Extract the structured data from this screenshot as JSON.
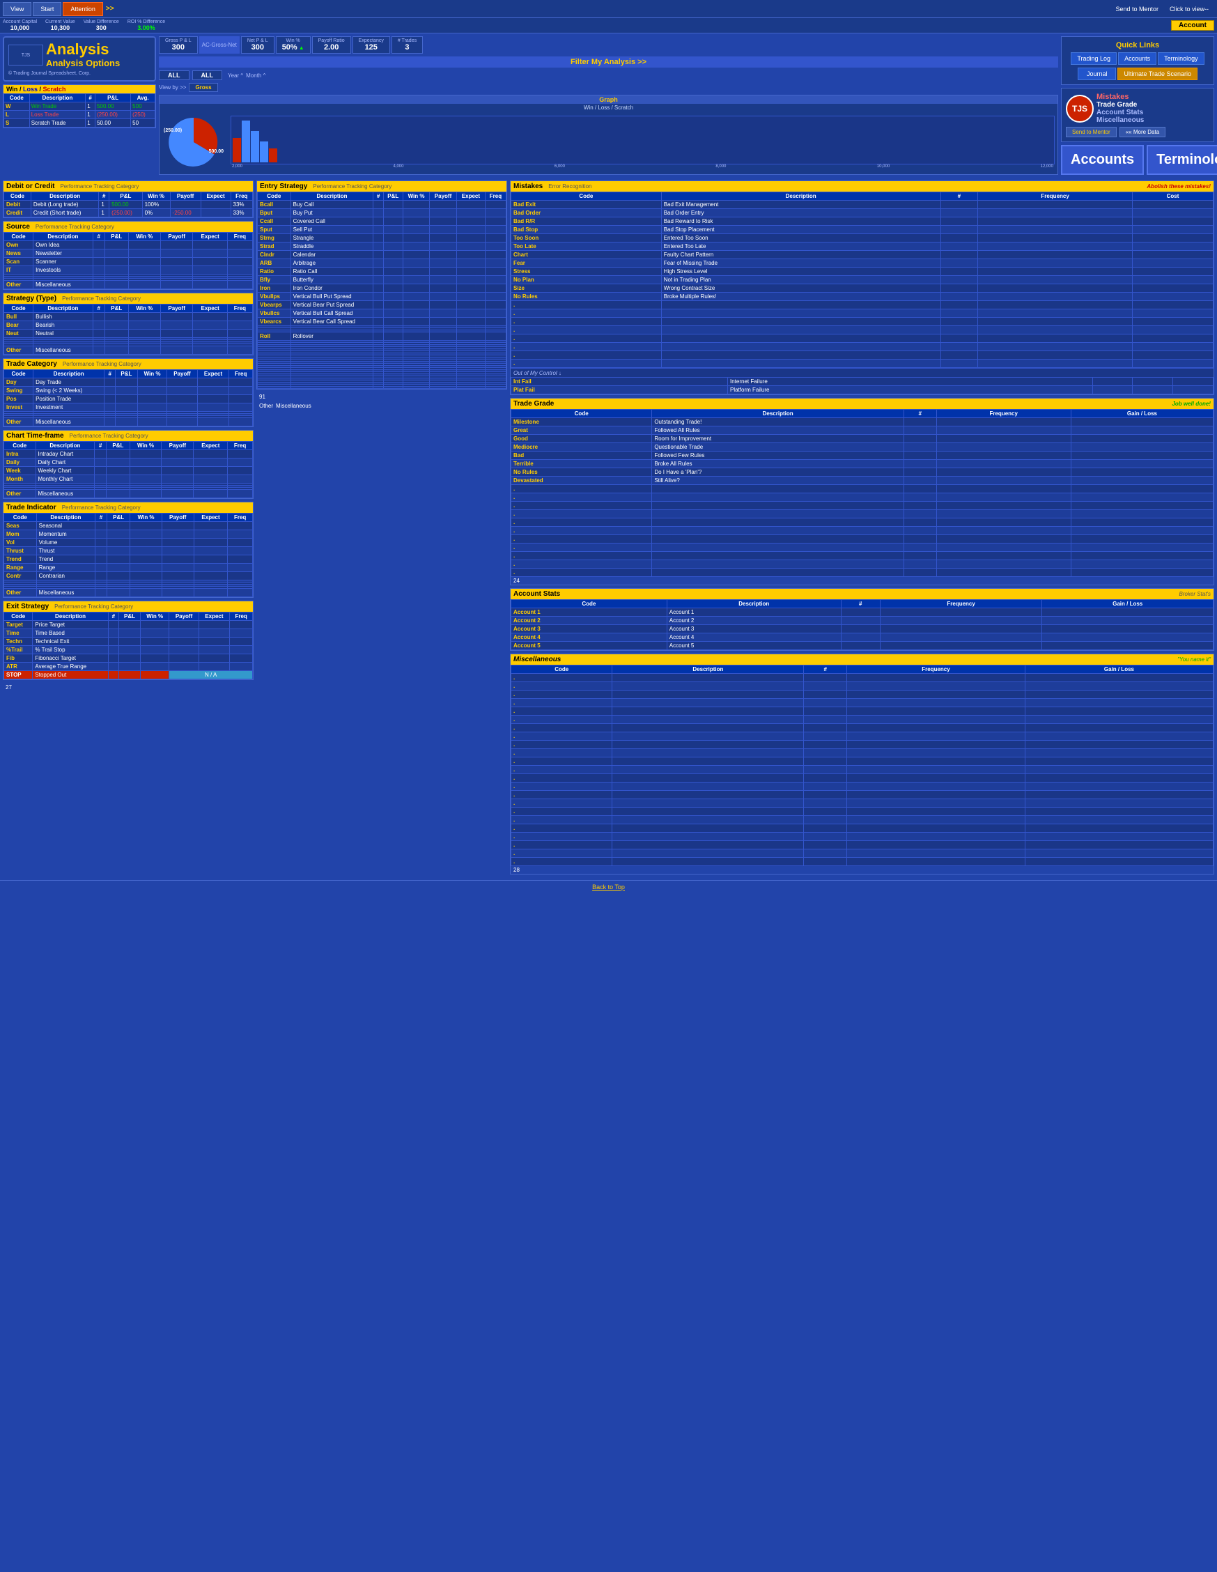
{
  "app": {
    "title": "Analysis Options",
    "subtitle": "Analysis",
    "copyright": "© Trading Journal Spreadsheet, Corp."
  },
  "topbar": {
    "view": "View",
    "start": "Start",
    "attention": "Attention",
    "nav_arrow": ">>",
    "send_to_mentor": "Send to Mentor",
    "click_to_view": "Click to view--",
    "more_data": "«« More Data"
  },
  "account_row": {
    "account_capital_label": "Account Capital",
    "current_value_label": "Current Value",
    "value_difference_label": "Value Difference",
    "roi_label": "ROI % Difference",
    "account_capital": "10,000",
    "current_value": "10,300",
    "value_difference": "300",
    "roi": "3.00%",
    "account_tab": "Account"
  },
  "stats": {
    "gross_pnl_label": "Gross P & L",
    "gross_pnl": "300",
    "ac_gross_net": "AC-Gross-Net",
    "net_pnl_label": "Net P & L",
    "net_pnl": "300",
    "win_label": "Win %",
    "win": "50%",
    "payoff_label": "Payoff Ratio",
    "payoff": "2.00",
    "expectancy_label": "Expectancy",
    "expectancy": "125",
    "trades_label": "# Trades",
    "trades": "3",
    "all1": "ALL",
    "all2": "ALL",
    "year_label": "Year ^",
    "month_label": "Month ^",
    "view_by": "View by >>",
    "gross_label": "Gross"
  },
  "graph": {
    "title": "Graph",
    "subtitle": "Win / Loss / Scratch",
    "bar_values": [
      12000,
      10000,
      8000,
      6000,
      4000,
      2000
    ],
    "pie_labels": [
      "(250.00)",
      "500.00"
    ],
    "pie_red_pct": 35,
    "pie_blue_pct": 65
  },
  "quick_links": {
    "title": "Quick Links",
    "filter_btn": "Filter My Analysis >>",
    "trading_log": "Trading Log",
    "accounts": "Accounts",
    "terminology": "Terminology",
    "journal": "Journal",
    "ultimate": "Ultimate Trade Scenario"
  },
  "win_loss": {
    "header": "Win / Loss / Scratch",
    "columns": [
      "Code",
      "Description",
      "#",
      "P&L",
      "Avg."
    ],
    "rows": [
      {
        "code": "W",
        "desc": "Win Trade",
        "num": "1",
        "pnl": "500.00",
        "avg": "500",
        "type": "win"
      },
      {
        "code": "L",
        "desc": "Loss Trade",
        "num": "1",
        "pnl": "(250.00)",
        "avg": "(250)",
        "type": "loss"
      },
      {
        "code": "S",
        "desc": "Scratch Trade",
        "num": "1",
        "pnl": "50.00",
        "avg": "50",
        "type": "scratch"
      }
    ]
  },
  "debit_credit": {
    "title": "Debit or Credit",
    "subtitle": "Performance Tracking Category",
    "columns": [
      "Code",
      "Description",
      "#",
      "P&L",
      "Win %",
      "Payoff Ratio",
      "Expectancy",
      "Frequency"
    ],
    "rows": [
      {
        "code": "Debit",
        "desc": "Debit (Long trade)",
        "num": "1",
        "pnl": "500.00",
        "win": "100%",
        "payoff": "",
        "expectancy": "",
        "frequency": "33%"
      },
      {
        "code": "Credit",
        "desc": "Credit (Short trade)",
        "num": "1",
        "pnl": "(250.00)",
        "win": "0%",
        "payoff": "-250.00",
        "expectancy": "",
        "frequency": "33%"
      }
    ]
  },
  "source": {
    "title": "Source",
    "subtitle": "Performance Tracking Category",
    "columns": [
      "Code",
      "Description",
      "#",
      "P&L",
      "Win %",
      "Payoff Ratio",
      "Expectancy",
      "Frequency"
    ],
    "rows": [
      {
        "code": "Own",
        "desc": "Own Idea"
      },
      {
        "code": "News",
        "desc": "Newsletter"
      },
      {
        "code": "Scan",
        "desc": "Scanner"
      },
      {
        "code": "IT",
        "desc": "Investools"
      },
      {
        "code": "",
        "desc": ""
      },
      {
        "code": "",
        "desc": ""
      },
      {
        "code": "",
        "desc": ""
      },
      {
        "code": "Other",
        "desc": "Miscellaneous"
      }
    ]
  },
  "strategy_type": {
    "title": "Strategy (Type)",
    "subtitle": "Performance Tracking Category",
    "columns": [
      "Code",
      "Description",
      "#",
      "P&L",
      "Win %",
      "Payoff Ratio",
      "Expectancy",
      "Frequency"
    ],
    "rows": [
      {
        "code": "Bull",
        "desc": "Bullish"
      },
      {
        "code": "Bear",
        "desc": "Bearish"
      },
      {
        "code": "Neut",
        "desc": "Neutral"
      },
      {
        "code": "",
        "desc": ""
      },
      {
        "code": "",
        "desc": ""
      },
      {
        "code": "",
        "desc": ""
      },
      {
        "code": "",
        "desc": ""
      },
      {
        "code": "Other",
        "desc": "Miscellaneous"
      }
    ]
  },
  "trade_category": {
    "title": "Trade Category",
    "subtitle": "Performance Tracking Category",
    "columns": [
      "Code",
      "Description",
      "#",
      "P&L",
      "Win %",
      "Payoff Ratio",
      "Expectancy",
      "Frequency"
    ],
    "rows": [
      {
        "code": "Day",
        "desc": "Day Trade"
      },
      {
        "code": "Swing",
        "desc": "Swing (< 2 Weeks)"
      },
      {
        "code": "Pos",
        "desc": "Position Trade"
      },
      {
        "code": "Invest",
        "desc": "Investment"
      },
      {
        "code": "",
        "desc": ""
      },
      {
        "code": "",
        "desc": ""
      },
      {
        "code": "",
        "desc": ""
      },
      {
        "code": "Other",
        "desc": "Miscellaneous"
      }
    ]
  },
  "chart_timeframe": {
    "title": "Chart Time-frame",
    "subtitle": "Performance Tracking Category",
    "columns": [
      "Code",
      "Description",
      "#",
      "P&L",
      "Win %",
      "Payoff Ratio",
      "Expectancy",
      "Frequency"
    ],
    "rows": [
      {
        "code": "Intra",
        "desc": "Intraday Chart"
      },
      {
        "code": "Daily",
        "desc": "Daily Chart"
      },
      {
        "code": "Week",
        "desc": "Weekly Chart"
      },
      {
        "code": "Month",
        "desc": "Monthly Chart"
      },
      {
        "code": "",
        "desc": ""
      },
      {
        "code": "",
        "desc": ""
      },
      {
        "code": "",
        "desc": ""
      },
      {
        "code": "Other",
        "desc": "Miscellaneous"
      }
    ]
  },
  "trade_indicator": {
    "title": "Trade Indicator",
    "subtitle": "Performance Tracking Category",
    "columns": [
      "Code",
      "Description",
      "#",
      "P&L",
      "Win %",
      "Payoff Ratio",
      "Expectancy",
      "Frequency"
    ],
    "rows": [
      {
        "code": "Seas",
        "desc": "Seasonal"
      },
      {
        "code": "Mom",
        "desc": "Momentum"
      },
      {
        "code": "Vol",
        "desc": "Volume"
      },
      {
        "code": "Thrust",
        "desc": "Thrust"
      },
      {
        "code": "Trend",
        "desc": "Trend"
      },
      {
        "code": "Range",
        "desc": "Range"
      },
      {
        "code": "Contr",
        "desc": "Contrarian"
      },
      {
        "code": "",
        "desc": ""
      },
      {
        "code": "",
        "desc": ""
      },
      {
        "code": "",
        "desc": ""
      },
      {
        "code": "",
        "desc": ""
      },
      {
        "code": "Other",
        "desc": "Miscellaneous"
      }
    ]
  },
  "exit_strategy": {
    "title": "Exit Strategy",
    "subtitle": "Performance Tracking Category",
    "columns": [
      "Code",
      "Description",
      "#",
      "P&L",
      "Win %",
      "Payoff Ratio",
      "Expectancy",
      "Frequency"
    ],
    "rows": [
      {
        "code": "Target",
        "desc": "Price Target"
      },
      {
        "code": "Time",
        "desc": "Time Based"
      },
      {
        "code": "Techn",
        "desc": "Technical Exit"
      },
      {
        "code": "%Trail",
        "desc": "% Trail Stop"
      },
      {
        "code": "Fib",
        "desc": "Fibonacci Target"
      },
      {
        "code": "ATR",
        "desc": "Average True Range"
      },
      {
        "code": "STOP",
        "desc": "Stopped Out",
        "stopped": true,
        "na": true
      }
    ]
  },
  "entry_strategy": {
    "title": "Entry Strategy",
    "subtitle": "Performance Tracking Category",
    "columns": [
      "Code",
      "Description",
      "#",
      "P&L",
      "Win %",
      "Payoff Ratio",
      "Expectancy",
      "Frequency"
    ],
    "rows": [
      {
        "code": "Bcall",
        "desc": "Buy Call"
      },
      {
        "code": "Bput",
        "desc": "Buy Put"
      },
      {
        "code": "Ccall",
        "desc": "Covered Call"
      },
      {
        "code": "Sput",
        "desc": "Sell Put"
      },
      {
        "code": "Strng",
        "desc": "Strangle"
      },
      {
        "code": "Strad",
        "desc": "Straddle"
      },
      {
        "code": "Clndr",
        "desc": "Calendar"
      },
      {
        "code": "ARB",
        "desc": "Arbitrage"
      },
      {
        "code": "Ratio",
        "desc": "Ratio Call"
      },
      {
        "code": "Bfly",
        "desc": "Butterfly"
      },
      {
        "code": "Iron",
        "desc": "Iron Condor"
      },
      {
        "code": "Vbullps",
        "desc": "Vertical Bull Put Spread"
      },
      {
        "code": "Vbearps",
        "desc": "Vertical Bear Put Spread"
      },
      {
        "code": "Vbullcs",
        "desc": "Vertical Bull Call Spread"
      },
      {
        "code": "Vbearcs",
        "desc": "Vertical Bear Call Spread"
      },
      {
        "code": "",
        "desc": ""
      },
      {
        "code": "",
        "desc": ""
      },
      {
        "code": "",
        "desc": ""
      },
      {
        "code": "Roll",
        "desc": "Rollover"
      },
      {
        "code": "",
        "desc": ""
      },
      {
        "code": "",
        "desc": ""
      },
      {
        "code": "",
        "desc": ""
      },
      {
        "code": "",
        "desc": ""
      },
      {
        "code": "",
        "desc": ""
      },
      {
        "code": "",
        "desc": ""
      },
      {
        "code": "",
        "desc": ""
      },
      {
        "code": "",
        "desc": ""
      },
      {
        "code": "",
        "desc": ""
      },
      {
        "code": "",
        "desc": ""
      },
      {
        "code": "",
        "desc": ""
      },
      {
        "code": "",
        "desc": ""
      },
      {
        "code": "",
        "desc": ""
      },
      {
        "code": "",
        "desc": ""
      },
      {
        "code": "",
        "desc": ""
      },
      {
        "code": "",
        "desc": ""
      },
      {
        "code": "",
        "desc": ""
      },
      {
        "code": "",
        "desc": ""
      },
      {
        "code": "",
        "desc": ""
      },
      {
        "code": "",
        "desc": ""
      },
      {
        "code": "",
        "desc": ""
      },
      {
        "code": "",
        "desc": ""
      },
      {
        "code": "",
        "desc": ""
      }
    ],
    "footer_num": "91",
    "footer_other": "Other",
    "footer_misc": "Miscellaneous"
  },
  "mistakes": {
    "title": "Mistakes",
    "subtitle": "Error Recognition",
    "action": "Abolish these mistakes!",
    "columns": [
      "Code",
      "Description",
      "#",
      "Frequency",
      "Cost"
    ],
    "rows": [
      {
        "code": "Bad Exit",
        "desc": "Bad Exit Management"
      },
      {
        "code": "Bad Order",
        "desc": "Bad Order Entry"
      },
      {
        "code": "Bad R/R",
        "desc": "Bad Reward to Risk"
      },
      {
        "code": "Bad Stop",
        "desc": "Bad Stop Placement"
      },
      {
        "code": "Too Soon",
        "desc": "Entered Too Soon"
      },
      {
        "code": "Too Late",
        "desc": "Entered Too Late"
      },
      {
        "code": "Chart",
        "desc": "Faulty Chart Pattern"
      },
      {
        "code": "Fear",
        "desc": "Fear of Missing Trade"
      },
      {
        "code": "Stress",
        "desc": "High Stress Level"
      },
      {
        "code": "No Plan",
        "desc": "Not in Trading Plan"
      },
      {
        "code": "Size",
        "desc": "Wrong Contract Size"
      },
      {
        "code": "No Rules",
        "desc": "Broke Multiple Rules!"
      },
      {
        "code": ".",
        "desc": ""
      },
      {
        "code": ".",
        "desc": ""
      },
      {
        "code": ".",
        "desc": ""
      },
      {
        "code": ".",
        "desc": ""
      },
      {
        "code": ".",
        "desc": ""
      },
      {
        "code": ".",
        "desc": ""
      },
      {
        "code": ".",
        "desc": ""
      },
      {
        "code": ".",
        "desc": ""
      }
    ],
    "out_of_control": "Out of My Control ↓",
    "int_fail_code": "Int Fail",
    "int_fail_desc": "Internet Failure",
    "plat_fail_code": "Plat Fail",
    "plat_fail_desc": "Platform Failure"
  },
  "trade_grade": {
    "title": "Trade Grade",
    "subtitle": "Job well done!",
    "columns": [
      "Code",
      "Description",
      "#",
      "Frequency",
      "Gain / Loss"
    ],
    "rows": [
      {
        "code": "Milestone",
        "desc": "Outstanding Trade!"
      },
      {
        "code": "Great",
        "desc": "Followed All Rules"
      },
      {
        "code": "Good",
        "desc": "Room for Improvement"
      },
      {
        "code": "Mediocre",
        "desc": "Questionable Trade"
      },
      {
        "code": "Bad",
        "desc": "Followed Few Rules"
      },
      {
        "code": "Terrible",
        "desc": "Broke All Rules"
      },
      {
        "code": "No Rules",
        "desc": "Do I Have a 'Plan'?"
      },
      {
        "code": "Devastated",
        "desc": "Still Alive?"
      },
      {
        "code": ".",
        "desc": ""
      },
      {
        "code": ".",
        "desc": ""
      },
      {
        "code": ".",
        "desc": ""
      },
      {
        "code": ".",
        "desc": ""
      },
      {
        "code": ".",
        "desc": ""
      },
      {
        "code": ".",
        "desc": ""
      },
      {
        "code": ".",
        "desc": ""
      },
      {
        "code": ".",
        "desc": ""
      },
      {
        "code": ".",
        "desc": ""
      },
      {
        "code": ".",
        "desc": ""
      },
      {
        "code": ".",
        "desc": ""
      }
    ],
    "number": "24"
  },
  "account_stats": {
    "title": "Account Stats",
    "subtitle": "Broker Stat's",
    "columns": [
      "Code",
      "Description",
      "#",
      "Frequency",
      "Gain / Loss"
    ],
    "rows": [
      {
        "code": "Account 1",
        "desc": "Account 1"
      },
      {
        "code": "Account 2",
        "desc": "Account 2"
      },
      {
        "code": "Account 3",
        "desc": "Account 3"
      },
      {
        "code": "Account 4",
        "desc": "Account 4"
      },
      {
        "code": "Account 5",
        "desc": "Account 5"
      }
    ]
  },
  "miscellaneous": {
    "title": "Miscellaneous",
    "subtitle": "\"You name it\"",
    "columns": [
      "Code",
      "Description",
      "#",
      "Frequency",
      "Gain / Loss"
    ],
    "rows": [
      {
        "code": ".",
        "desc": ""
      },
      {
        "code": ".",
        "desc": ""
      },
      {
        "code": ".",
        "desc": ""
      },
      {
        "code": ".",
        "desc": ""
      },
      {
        "code": ".",
        "desc": ""
      },
      {
        "code": ".",
        "desc": ""
      },
      {
        "code": ".",
        "desc": ""
      },
      {
        "code": ".",
        "desc": ""
      },
      {
        "code": ".",
        "desc": ""
      },
      {
        "code": ".",
        "desc": ""
      },
      {
        "code": ".",
        "desc": ""
      },
      {
        "code": ".",
        "desc": ""
      },
      {
        "code": ".",
        "desc": ""
      },
      {
        "code": ".",
        "desc": ""
      },
      {
        "code": ".",
        "desc": ""
      },
      {
        "code": ".",
        "desc": ""
      },
      {
        "code": ".",
        "desc": ""
      },
      {
        "code": ".",
        "desc": ""
      },
      {
        "code": ".",
        "desc": ""
      },
      {
        "code": ".",
        "desc": ""
      },
      {
        "code": ".",
        "desc": ""
      },
      {
        "code": ".",
        "desc": ""
      },
      {
        "code": ".",
        "desc": ""
      }
    ],
    "number": "28"
  },
  "nav_tabs": {
    "accounts": "Accounts",
    "terminology": "Terminology"
  },
  "footer": {
    "back_to_top": "Back to Top",
    "left_num": "27",
    "right_num": "28"
  },
  "right_side": {
    "mistakes_label": "Mistakes",
    "trade_grade_label": "Trade Grade",
    "account_stats_label": "Account Stats",
    "miscellaneous_label": "Miscellaneous"
  }
}
